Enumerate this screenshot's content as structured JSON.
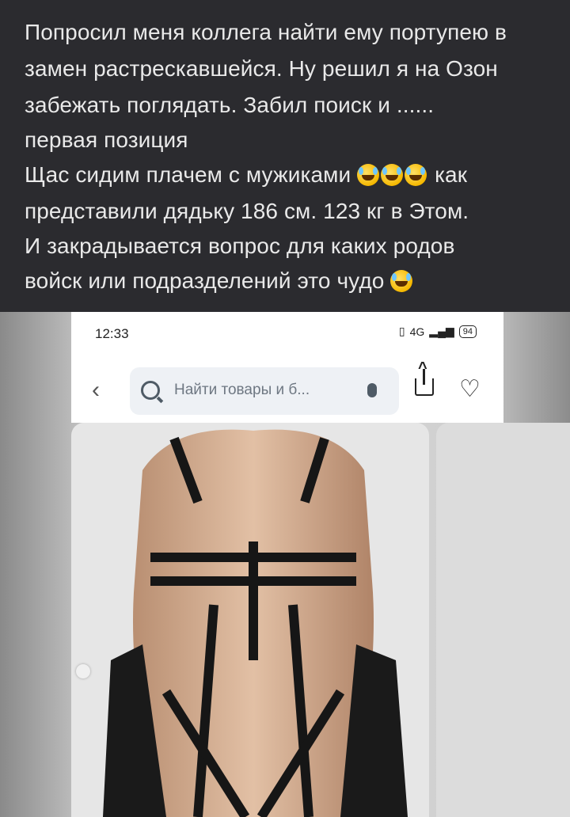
{
  "post": {
    "lines": [
      "Попросил меня коллега найти ему портупею в",
      "замен растрескавшейся. Ну решил я на Озон",
      "забежать поглядать. Забил поиск и ......",
      "первая позиция",
      "Щас сидим плачем с мужиками",
      "как",
      "представили дядьку 186 см. 123 кг в Этом.",
      "И закрадывается вопрос для каких родов",
      "войск или подразделений это чудо"
    ],
    "emoji": "rolling-on-floor-laughing-emoji"
  },
  "phone": {
    "time": "12:33",
    "signal": "4G",
    "battery": "94",
    "search_placeholder": "Найти товары и б..."
  },
  "colors": {
    "background": "#2b2b2f",
    "text": "#e9e9e9"
  }
}
